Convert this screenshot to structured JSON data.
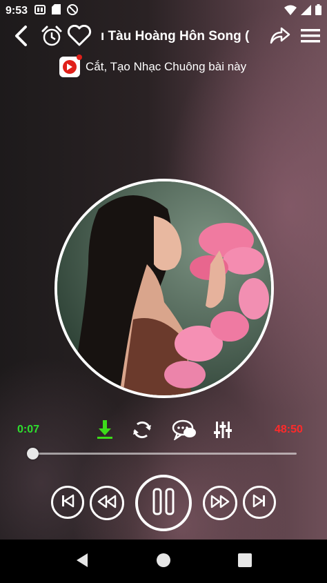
{
  "status_bar": {
    "time": "9:53",
    "icons": [
      "sim-card-icon",
      "sd-card-icon",
      "no-disturb-icon",
      "wifi-icon",
      "signal-icon",
      "battery-icon"
    ]
  },
  "header": {
    "song_title": "ı Tàu Hoàng Hôn Song (",
    "icons": [
      "back-arrow-icon",
      "alarm-icon",
      "heart-icon",
      "share-icon",
      "menu-icon"
    ]
  },
  "ringtone": {
    "label": "Cắt, Tạo Nhạc Chuông bài này"
  },
  "player": {
    "current_time": "0:07",
    "total_time": "48:50",
    "progress": 0.0024,
    "colors": {
      "current_time": "#2ee02e",
      "total_time": "#ff2a2a",
      "download": "#3ddc1a"
    },
    "action_icons": [
      "download-icon",
      "repeat-icon",
      "lyrics-chat-icon",
      "equalizer-icon"
    ],
    "controls": [
      "skip-previous-icon",
      "rewind-icon",
      "pause-icon",
      "fast-forward-icon",
      "skip-next-icon"
    ]
  },
  "nav": {
    "icons": [
      "nav-back-icon",
      "nav-home-icon",
      "nav-recents-icon"
    ]
  }
}
